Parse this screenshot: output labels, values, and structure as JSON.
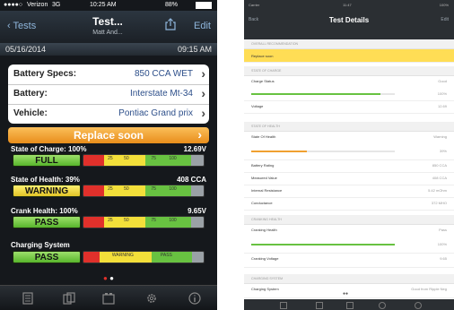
{
  "phone1": {
    "status_bar": {
      "carrier": "Verizon",
      "network": "3G",
      "time": "10:25 AM",
      "battery": "88%"
    },
    "nav": {
      "back_label": "Tests",
      "title": "Test...",
      "subtitle": "Matt And...",
      "edit_label": "Edit"
    },
    "date": "05/16/2014",
    "time": "09:15 AM",
    "info_rows": [
      {
        "label": "Battery Specs:",
        "value": "850 CCA WET"
      },
      {
        "label": "Battery:",
        "value": "Interstate Mt-34"
      },
      {
        "label": "Vehicle:",
        "value": "Pontiac Grand prix"
      }
    ],
    "action": {
      "label": "Replace soon"
    },
    "metrics": [
      {
        "label": "State of Charge: 100%",
        "value": "12.69V",
        "status": "FULL",
        "status_color": "green",
        "level": 1.0,
        "ticks": [
          "25",
          "50",
          "75",
          "100"
        ]
      },
      {
        "label": "State of Health: 39%",
        "value": "408 CCA",
        "status": "WARNING",
        "status_color": "yellow",
        "level": 0.39,
        "ticks": [
          "25",
          "50",
          "75",
          "100"
        ]
      },
      {
        "label": "Crank Health: 100%",
        "value": "9.65V",
        "status": "PASS",
        "status_color": "green",
        "level": 1.0,
        "ticks": [
          "25",
          "50",
          "75",
          "100"
        ]
      },
      {
        "label": "Charging System",
        "value": "",
        "status": "PASS",
        "status_color": "green",
        "level": 0.75,
        "ticks": [
          "WARNING",
          "PASS"
        ]
      }
    ],
    "page_dots": {
      "count": 2,
      "active": 0
    },
    "tabs": [
      "tests-icon",
      "copy-icon",
      "battery-icon",
      "gear-icon",
      "info-icon"
    ],
    "colors": {
      "accent_orange": "#f0a030",
      "pass_green": "#68c241",
      "warn_yellow": "#f3df3a",
      "fail_red": "#e0302b",
      "link_blue": "#8fb6dc"
    }
  },
  "phone2": {
    "status_bar": {
      "carrier": "Carrier",
      "time": "11:47",
      "battery": "100%"
    },
    "nav": {
      "back_label": "Back",
      "title": "Test Details",
      "subtitle": "",
      "edit_label": "Edit"
    },
    "sections": [
      {
        "header": "OVERALL RECOMMENDATION",
        "rows": [
          {
            "label": "Replace soon",
            "value": "",
            "highlight": true
          }
        ]
      },
      {
        "header": "STATE OF CHARGE",
        "rows": [
          {
            "label": "Charge Status",
            "value": "Good",
            "bar": 0.9,
            "bar_color": "#68c241",
            "bar_value": "100%"
          },
          {
            "label": "Voltage",
            "value": "12.69"
          }
        ]
      },
      {
        "header": "STATE OF HEALTH",
        "rows": [
          {
            "label": "State Of Health",
            "value": "Warning",
            "bar": 0.39,
            "bar_color": "#f0a030",
            "bar_value": "39%"
          },
          {
            "label": "Battery Rating",
            "value": "850 CCA"
          },
          {
            "label": "Measured Value",
            "value": "408 CCA"
          },
          {
            "label": "Internal Resistance",
            "value": "5.42 mOhm"
          },
          {
            "label": "Conductance",
            "value": "372 MHO"
          }
        ]
      },
      {
        "header": "CRANKING HEALTH",
        "rows": [
          {
            "label": "Cranking Health",
            "value": "Pass",
            "bar": 1.0,
            "bar_color": "#68c241",
            "bar_value": "100%"
          },
          {
            "label": "Cranking Voltage",
            "value": "9.65"
          }
        ]
      },
      {
        "header": "CHARGING SYSTEM",
        "rows": [
          {
            "label": "Charging System",
            "value": "Good from Ripple Neg"
          }
        ]
      }
    ],
    "page_dots": {
      "count": 2,
      "active": 1
    }
  }
}
